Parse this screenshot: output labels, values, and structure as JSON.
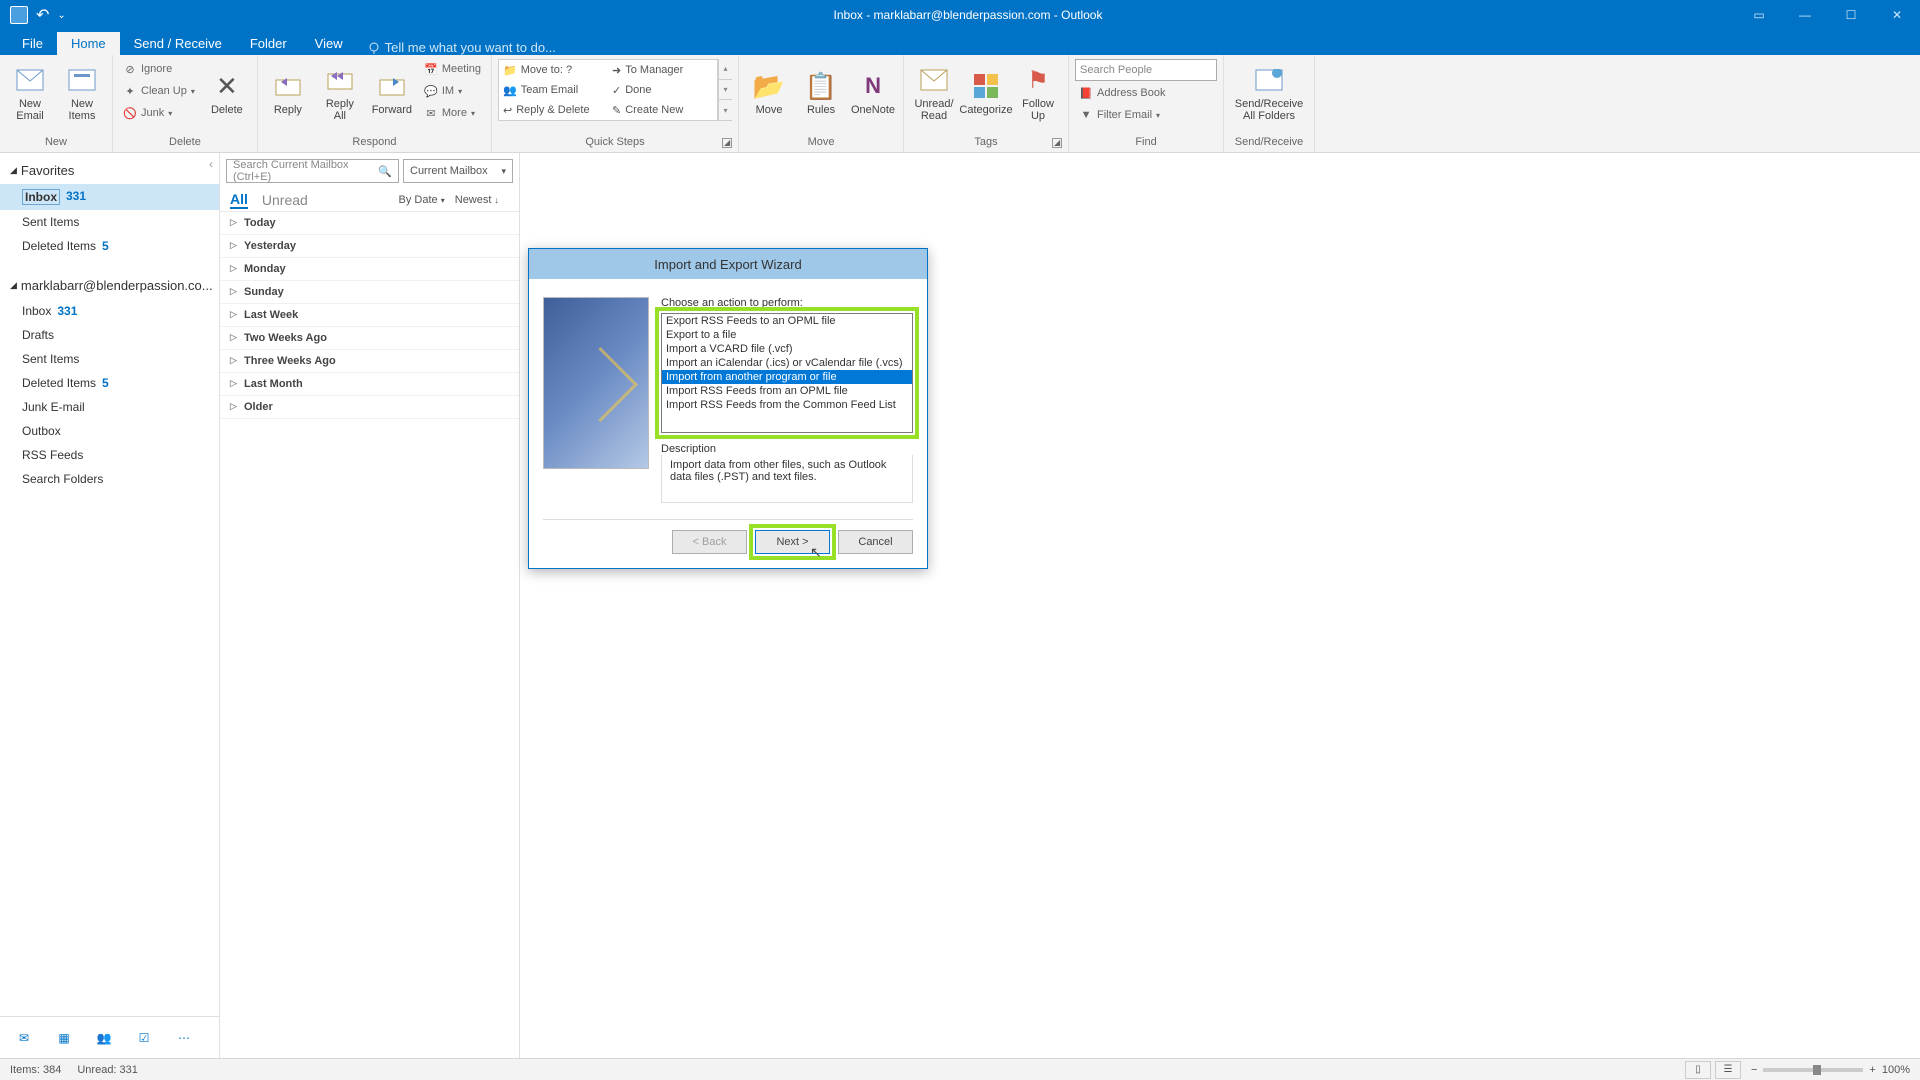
{
  "titlebar": {
    "title": "Inbox - marklabarr@blenderpassion.com - Outlook"
  },
  "tabs": {
    "file": "File",
    "home": "Home",
    "sendreceive": "Send / Receive",
    "folder": "Folder",
    "view": "View",
    "tellme": "Tell me what you want to do..."
  },
  "ribbon": {
    "new": {
      "email": "New\nEmail",
      "items": "New\nItems",
      "label": "New"
    },
    "delete": {
      "ignore": "Ignore",
      "cleanup": "Clean Up",
      "junk": "Junk",
      "delete": "Delete",
      "label": "Delete"
    },
    "respond": {
      "reply": "Reply",
      "replyall": "Reply\nAll",
      "forward": "Forward",
      "meeting": "Meeting",
      "im": "IM",
      "more": "More",
      "label": "Respond"
    },
    "quicksteps": {
      "moveto": "Move to: ?",
      "tomanager": "To Manager",
      "teamemail": "Team Email",
      "done": "Done",
      "replydelete": "Reply & Delete",
      "createnew": "Create New",
      "label": "Quick Steps"
    },
    "move": {
      "move": "Move",
      "rules": "Rules",
      "onenote": "OneNote",
      "label": "Move"
    },
    "tags": {
      "unread": "Unread/\nRead",
      "categorize": "Categorize",
      "followup": "Follow\nUp",
      "label": "Tags"
    },
    "find": {
      "searchpeople": "Search People",
      "addressbook": "Address Book",
      "filter": "Filter Email",
      "label": "Find"
    },
    "sendreceive": {
      "btn": "Send/Receive\nAll Folders",
      "label": "Send/Receive"
    }
  },
  "nav": {
    "favorites": "Favorites",
    "inbox": {
      "name": "Inbox",
      "count": "331"
    },
    "sentitems": "Sent Items",
    "deleted": {
      "name": "Deleted Items",
      "count": "5"
    },
    "account": "marklabarr@blenderpassion.co...",
    "inbox2": {
      "name": "Inbox",
      "count": "331"
    },
    "drafts": "Drafts",
    "sentitems2": "Sent Items",
    "deleted2": {
      "name": "Deleted Items",
      "count": "5"
    },
    "junk": "Junk E-mail",
    "outbox": "Outbox",
    "rss": "RSS Feeds",
    "searchfolders": "Search Folders"
  },
  "list": {
    "search_placeholder": "Search Current Mailbox (Ctrl+E)",
    "scope": "Current Mailbox",
    "all": "All",
    "unread": "Unread",
    "bydate": "By Date",
    "newest": "Newest",
    "groups": [
      "Today",
      "Yesterday",
      "Monday",
      "Sunday",
      "Last Week",
      "Two Weeks Ago",
      "Three Weeks Ago",
      "Last Month",
      "Older"
    ]
  },
  "dialog": {
    "title": "Import and Export Wizard",
    "prompt": "Choose an action to perform:",
    "options": [
      "Export RSS Feeds to an OPML file",
      "Export to a file",
      "Import a VCARD file (.vcf)",
      "Import an iCalendar (.ics) or vCalendar file (.vcs)",
      "Import from another program or file",
      "Import RSS Feeds from an OPML file",
      "Import RSS Feeds from the Common Feed List"
    ],
    "selected_index": 4,
    "desc_label": "Description",
    "desc_text": "Import data from other files, such as Outlook data files (.PST) and text files.",
    "back": "< Back",
    "next": "Next >",
    "cancel": "Cancel"
  },
  "status": {
    "items": "Items: 384",
    "unread": "Unread: 331",
    "zoom": "100%"
  }
}
